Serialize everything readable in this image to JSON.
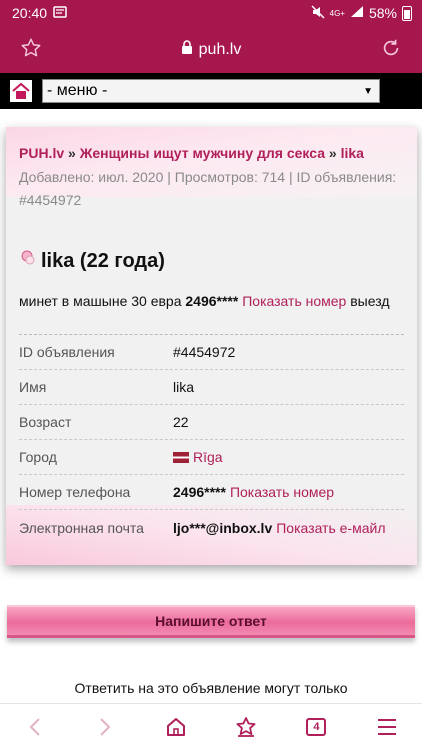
{
  "status_bar": {
    "time": "20:40",
    "network": "4G+",
    "battery": "58%"
  },
  "browser": {
    "url": "puh.lv",
    "tabs_count": "4"
  },
  "nav": {
    "menu_selected": "- меню -"
  },
  "breadcrumb": {
    "site": "PUH.lv",
    "separator": "»",
    "category": "Женщины ищут мужчину для секса",
    "current": "lika"
  },
  "meta": {
    "text": "Добавлено: июл. 2020 | Просмотров: 714 | ID объявления: #4454972"
  },
  "ad": {
    "title": "lika (22 года)",
    "desc_before": "минет в машыне 30 евра",
    "phone_masked": "2496****",
    "show_phone": "Показать номер",
    "desc_after": "выезд"
  },
  "details": {
    "id_label": "ID объявления",
    "id_value": "#4454972",
    "name_label": "Имя",
    "name_value": "lika",
    "age_label": "Возраст",
    "age_value": "22",
    "city_label": "Город",
    "city_value": "Rīga",
    "phone_label": "Номер телефона",
    "phone_value": "2496****",
    "phone_link": "Показать номер",
    "email_label": "Электронная почта",
    "email_value": "ljo***@inbox.lv",
    "email_link": "Показать е-майл"
  },
  "reply": {
    "button": "Напишите ответ",
    "note": "Ответить на это объявление могут только"
  },
  "colors": {
    "brand": "#a5174d",
    "link": "#b01f5a"
  }
}
